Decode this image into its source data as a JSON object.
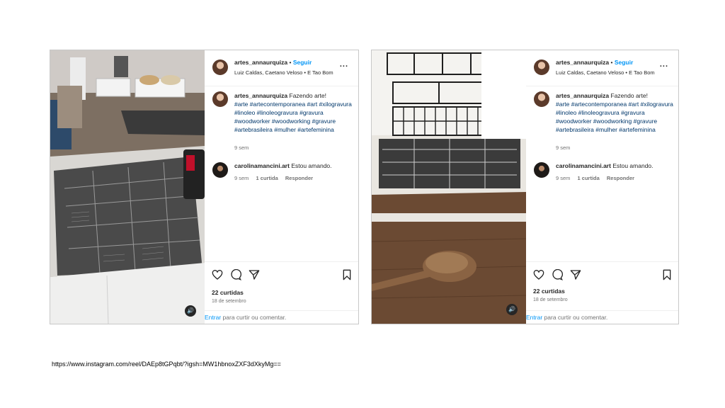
{
  "posts": [
    {
      "username": "artes_annaurquiza",
      "follow_label": "Seguir",
      "audio": "Luiz Caldas, Caetano Veloso • E Tao Bom",
      "more_label": "...",
      "caption_user": "artes_annaurquiza",
      "caption_text": "Fazendo arte!",
      "hashtags": "#arte #artecontemporanea #art #xilogravura #linoleo #linoleogravura #gravura #woodworker #woodworking #gravure #artebrasileira #mulher #artefeminina",
      "caption_time": "9 sem",
      "comment_user": "carolinamancini.art",
      "comment_text": "Estou amando.",
      "comment_time": "9 sem",
      "comment_likes": "1 curtida",
      "reply_label": "Responder",
      "likes": "22 curtidas",
      "date": "18 de setembro",
      "login_link": "Entrar",
      "login_text": "para curtir ou comentar."
    },
    {
      "username": "artes_annaurquiza",
      "follow_label": "Seguir",
      "audio": "Luiz Caldas, Caetano Veloso • E Tao Bom",
      "more_label": "...",
      "caption_user": "artes_annaurquiza",
      "caption_text": "Fazendo arte!",
      "hashtags": "#arte #artecontemporanea #art #xilogravura #linoleo #linoleogravura #gravura #woodworker #woodworking #gravure #artebrasileira #mulher #artefeminina",
      "caption_time": "9 sem",
      "comment_user": "carolinamancini.art",
      "comment_text": "Estou amando.",
      "comment_time": "9 sem",
      "comment_likes": "1 curtida",
      "reply_label": "Responder",
      "likes": "22 curtidas",
      "date": "18 de setembro",
      "login_link": "Entrar",
      "login_text": "para curtir ou comentar."
    }
  ],
  "url": "https://www.instagram.com/reel/DAEp8tGPqbt/?igsh=MW1hbnoxZXF3dXkyMg==",
  "icons": [
    "heart-icon",
    "comment-icon",
    "share-icon",
    "bookmark-icon",
    "sound-icon"
  ],
  "colors": {
    "link": "#0095f6",
    "hashtag": "#00376b",
    "muted": "#737373"
  }
}
